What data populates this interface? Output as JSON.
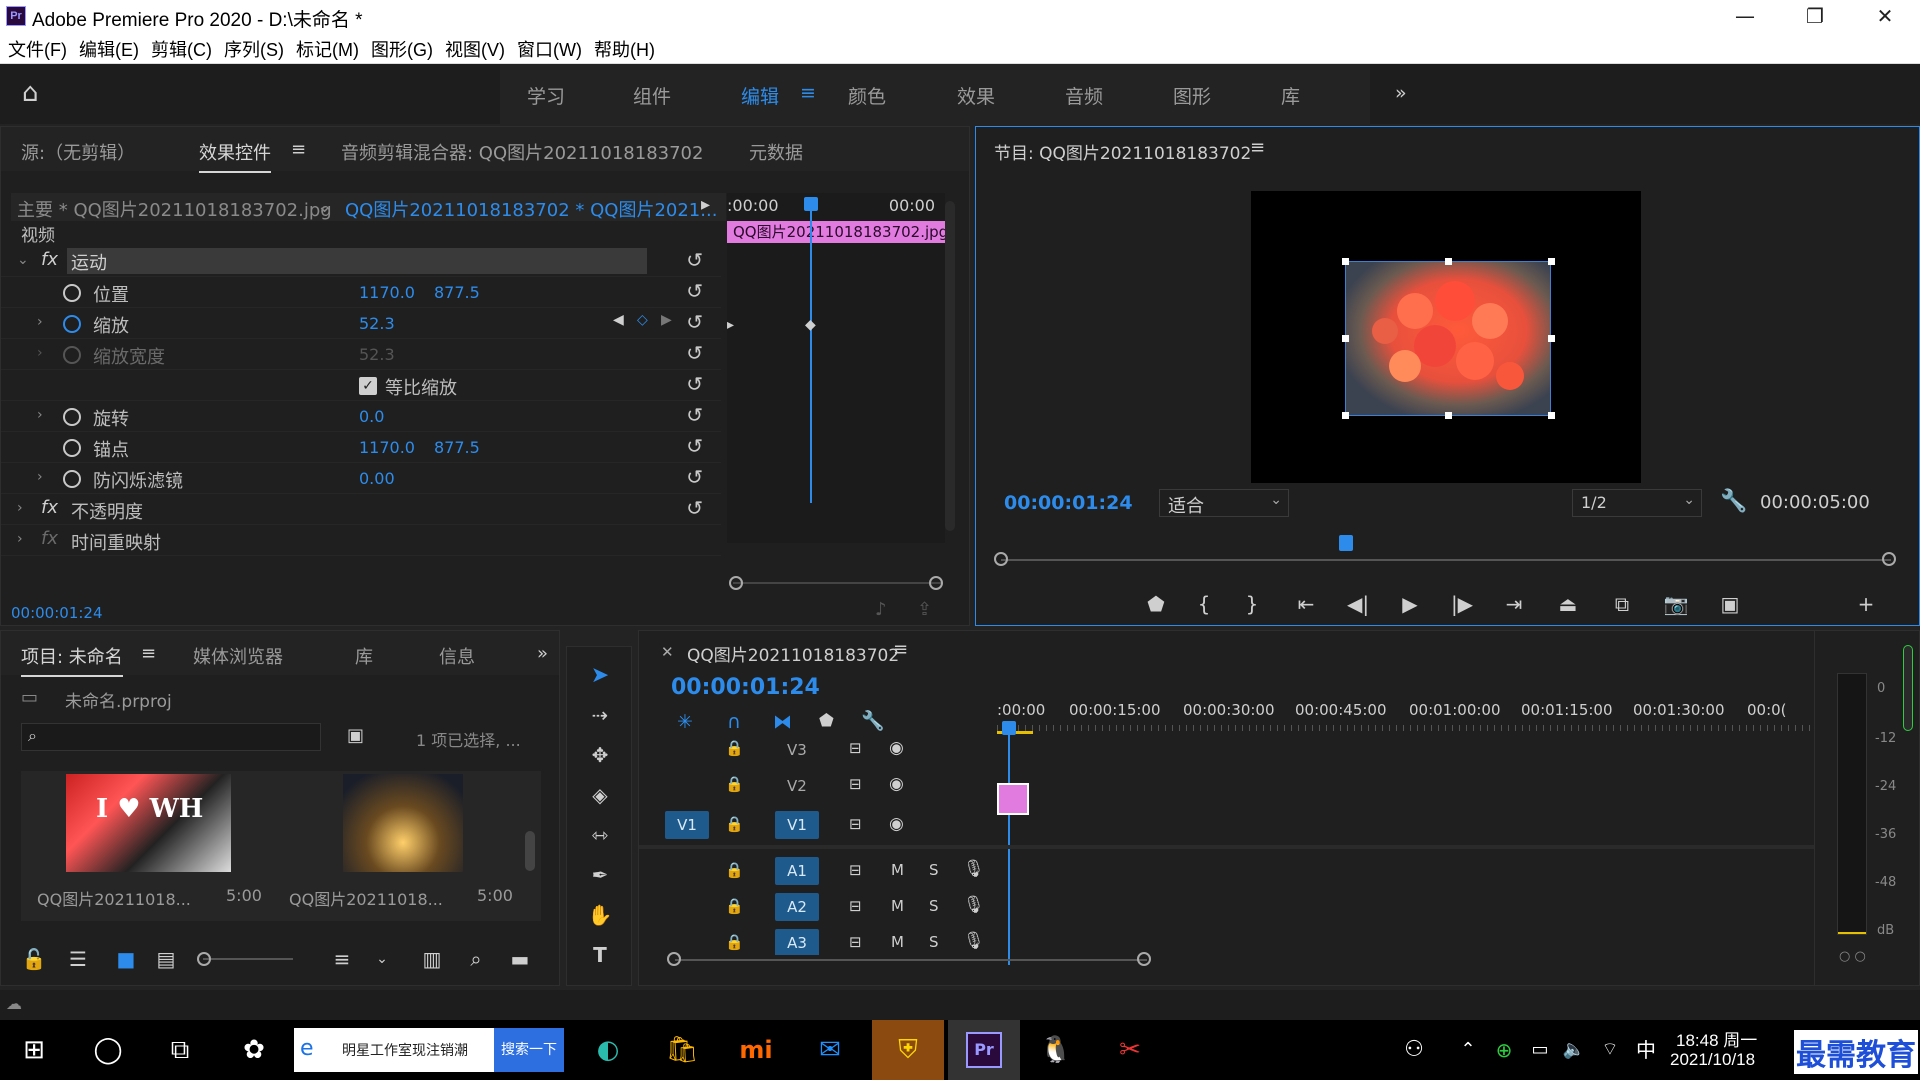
{
  "window": {
    "title": "Adobe Premiere Pro 2020 - D:\\未命名 *",
    "logo": "Pr"
  },
  "menu": [
    "文件(F)",
    "编辑(E)",
    "剪辑(C)",
    "序列(S)",
    "标记(M)",
    "图形(G)",
    "视图(V)",
    "窗口(W)",
    "帮助(H)"
  ],
  "workspaces": {
    "tabs": [
      "学习",
      "组件",
      "编辑",
      "颜色",
      "效果",
      "音频",
      "图形",
      "库"
    ],
    "active": "编辑"
  },
  "source_panel": {
    "tabs": [
      "源:（无剪辑）",
      "效果控件",
      "音频剪辑混合器: QQ图片20211018183702",
      "元数据"
    ],
    "master_label": "主要 * QQ图片20211018183702.jpg",
    "sequence_label": "QQ图片20211018183702 * QQ图片2021...",
    "time_start": ":00:00",
    "time_end": "00:00",
    "clip_label": "QQ图片20211018183702.jpg",
    "video_label": "视频",
    "effects": {
      "motion": "运动",
      "position": {
        "label": "位置",
        "x": "1170.0",
        "y": "877.5"
      },
      "scale": {
        "label": "缩放",
        "value": "52.3"
      },
      "scale_width": {
        "label": "缩放宽度",
        "value": "52.3"
      },
      "uniform_scale": "等比缩放",
      "rotation": {
        "label": "旋转",
        "value": "0.0"
      },
      "anchor": {
        "label": "锚点",
        "x": "1170.0",
        "y": "877.5"
      },
      "flicker": {
        "label": "防闪烁滤镜",
        "value": "0.00"
      },
      "opacity": "不透明度",
      "time_remap": "时间重映射"
    },
    "current_time": "00:00:01:24"
  },
  "program_panel": {
    "title": "节目: QQ图片20211018183702",
    "timecode": "00:00:01:24",
    "fit": "适合",
    "resolution": "1/2",
    "duration": "00:00:05:00"
  },
  "project_panel": {
    "tabs": [
      "项目: 未命名",
      "媒体浏览器",
      "库",
      "信息"
    ],
    "file": "未命名.prproj",
    "selection": "1 项已选择, ...",
    "items": [
      {
        "name": "QQ图片20211018...",
        "duration": "5:00"
      },
      {
        "name": "QQ图片20211018...",
        "duration": "5:00"
      }
    ]
  },
  "timeline": {
    "title": "QQ图片20211018183702",
    "timecode": "00:00:01:24",
    "ruler": [
      ":00:00",
      "00:00:15:00",
      "00:00:30:00",
      "00:00:45:00",
      "00:01:00:00",
      "00:01:15:00",
      "00:01:30:00",
      "00:0("
    ],
    "video_tracks": [
      "V3",
      "V2",
      "V1"
    ],
    "source_patch": "V1",
    "audio_tracks": [
      "A1",
      "A2",
      "A3"
    ],
    "mute": "M",
    "solo": "S"
  },
  "meter": {
    "labels": [
      "0",
      "-12",
      "-24",
      "-36",
      "-48",
      "dB"
    ]
  },
  "taskbar": {
    "search_text": "明星工作室现注销潮",
    "search_button": "搜索一下",
    "time": "18:48 周一",
    "date": "2021/10/18",
    "ime": "中",
    "watermark": "最需教育"
  }
}
